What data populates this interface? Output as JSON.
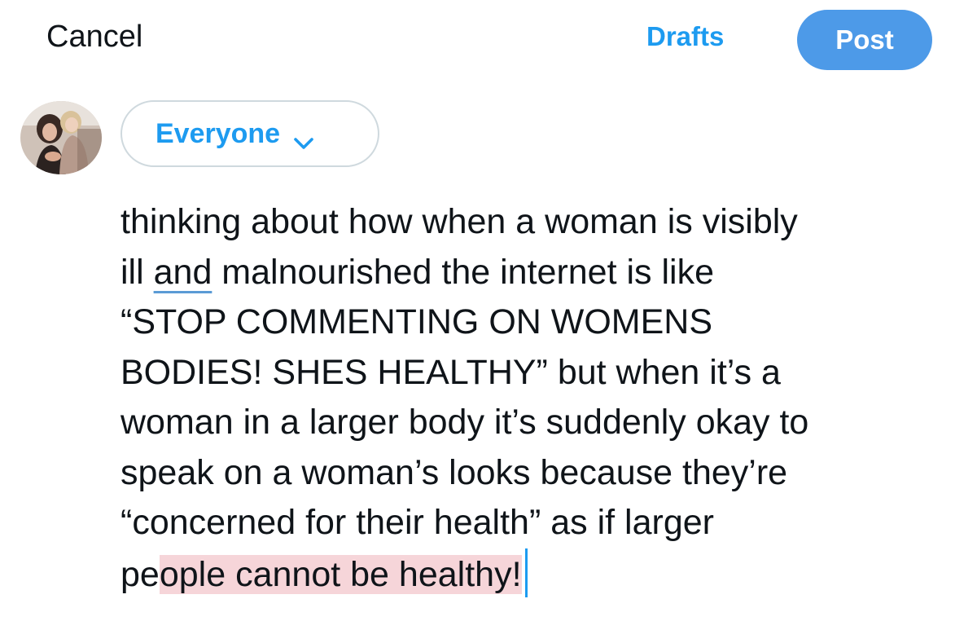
{
  "colors": {
    "accent": "#1d9bf0",
    "post_button_bg": "#4d9ae8",
    "selection_highlight": "#f6d5d9",
    "spellcheck_underline": "#5b9bd5"
  },
  "header": {
    "cancel_label": "Cancel",
    "drafts_label": "Drafts",
    "post_label": "Post"
  },
  "composer": {
    "avatar_icon": "profile-photo",
    "audience_label": "Everyone",
    "audience_icon": "chevron-down-icon",
    "lines": [
      "thinking about how when a woman is visibly",
      "ill ",
      "and",
      " malnourished the internet is like",
      "“STOP COMMENTING ON WOMENS",
      "BODIES! SHES HEALTHY” but when it’s a",
      "woman in a larger body it’s suddenly okay to",
      "speak on a woman’s looks because they’re",
      "“concerned for their health” as if larger",
      "pe",
      "ople cannot be healthy!"
    ]
  }
}
